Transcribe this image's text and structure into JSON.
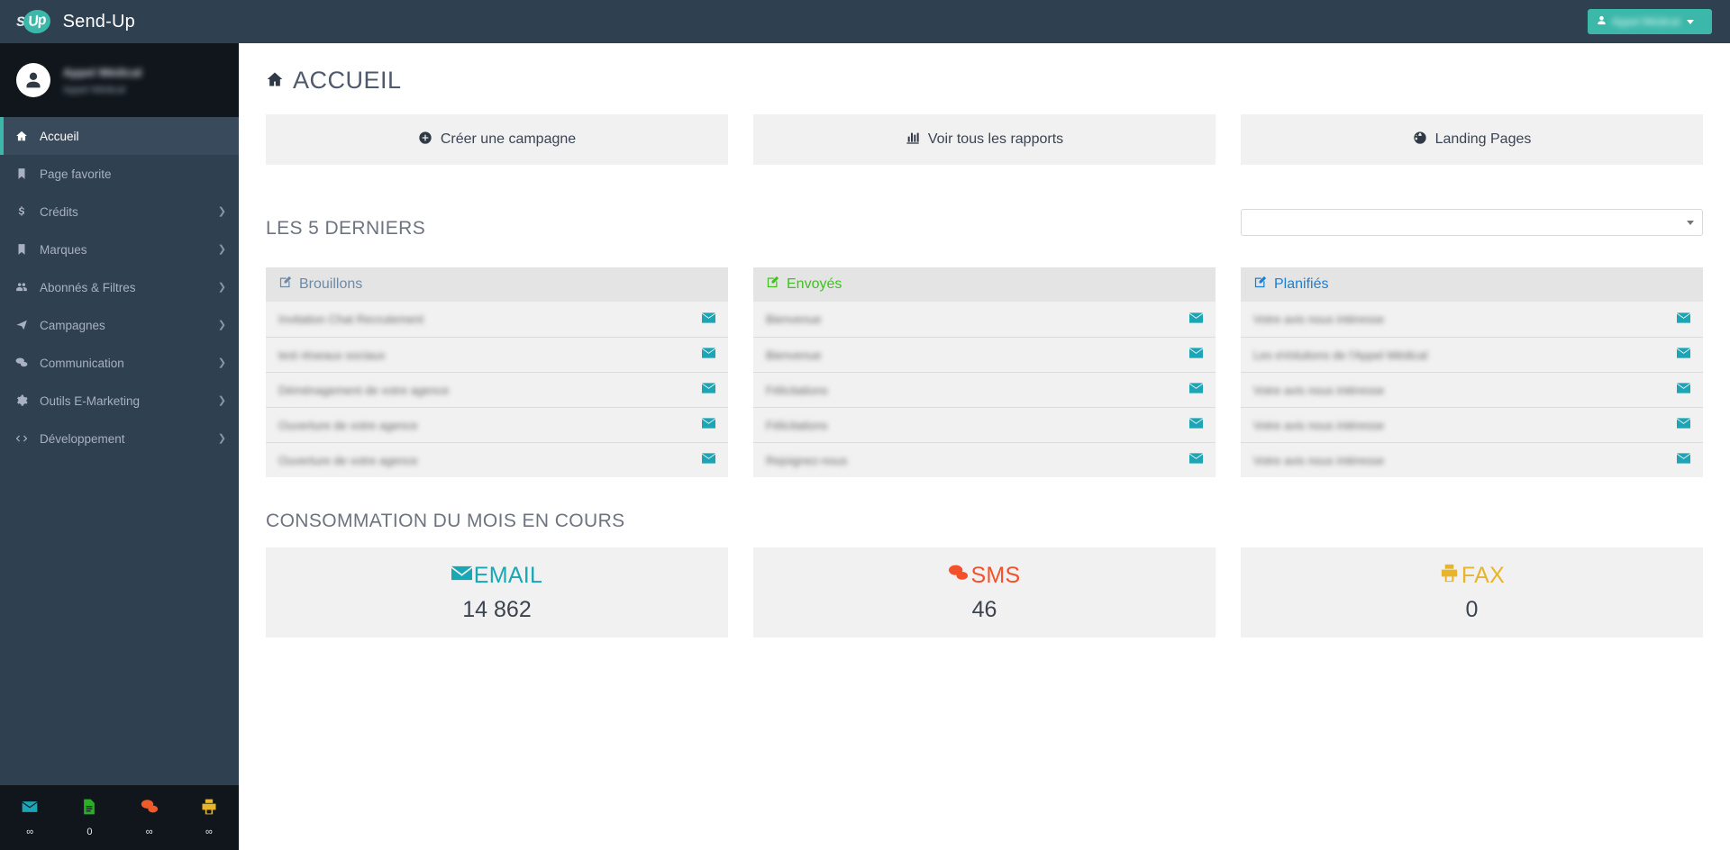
{
  "topbar": {
    "logo_s": "s",
    "logo_up": "Up",
    "brand_name": "Send-Up",
    "account_label": "Appel Médical",
    "account_icon": "user-icon",
    "caret_icon": "chevron-down-icon"
  },
  "sidebar": {
    "profile": {
      "name": "Appel Médical",
      "subtitle": "Appel Médical",
      "avatar_icon": "user-avatar-icon"
    },
    "items": [
      {
        "label": "Accueil",
        "icon": "home-icon",
        "active": true,
        "arrow": ""
      },
      {
        "label": "Page favorite",
        "icon": "bookmark-icon",
        "active": false,
        "arrow": ""
      },
      {
        "label": "Crédits",
        "icon": "dollar-icon",
        "active": false,
        "arrow": "❯"
      },
      {
        "label": "Marques",
        "icon": "bookmark-icon",
        "active": false,
        "arrow": "❯"
      },
      {
        "label": "Abonnés & Filtres",
        "icon": "users-icon",
        "active": false,
        "arrow": "❯"
      },
      {
        "label": "Campagnes",
        "icon": "paper-plane-icon",
        "active": false,
        "arrow": "❯"
      },
      {
        "label": "Communication",
        "icon": "comments-icon",
        "active": false,
        "arrow": "❯"
      },
      {
        "label": "Outils E-Marketing",
        "icon": "gear-icon",
        "active": false,
        "arrow": "❯"
      },
      {
        "label": "Développement",
        "icon": "code-icon",
        "active": false,
        "arrow": "❯"
      }
    ],
    "footer": [
      {
        "icon": "envelope-icon",
        "count": "∞",
        "color": "#1ba5b5"
      },
      {
        "icon": "file-text-icon",
        "count": "0",
        "color": "#2aad27"
      },
      {
        "icon": "comments-icon",
        "count": "∞",
        "color": "#f05a28"
      },
      {
        "icon": "fax-icon",
        "count": "∞",
        "color": "#e8b42c"
      }
    ]
  },
  "main": {
    "page_title": "ACCUEIL",
    "page_title_icon": "home-icon",
    "actions": [
      {
        "label": "Créer une campagne",
        "icon": "plus-circle-icon"
      },
      {
        "label": "Voir tous les rapports",
        "icon": "bar-chart-icon"
      },
      {
        "label": "Landing Pages",
        "icon": "globe-icon"
      }
    ],
    "latest_heading": "LES 5 DERNIERS",
    "brand_select": {
      "value": "",
      "placeholder": "",
      "caret_icon": "chevron-down-icon"
    },
    "panels": [
      {
        "title": "Brouillons",
        "title_color": "#6d8aa6",
        "icon": "edit-icon",
        "rows": [
          {
            "text": "Invitation Chat Recrutement",
            "icon": "envelope-icon"
          },
          {
            "text": "test réseaux sociaux",
            "icon": "envelope-icon"
          },
          {
            "text": "Déménagement de votre agence",
            "icon": "envelope-icon"
          },
          {
            "text": "Ouverture de votre agence",
            "icon": "envelope-icon"
          },
          {
            "text": "Ouverture de votre agence",
            "icon": "envelope-icon"
          }
        ]
      },
      {
        "title": "Envoyés",
        "title_color": "#3fc21f",
        "icon": "edit-icon",
        "rows": [
          {
            "text": "Bienvenue",
            "icon": "envelope-icon"
          },
          {
            "text": "Bienvenue",
            "icon": "envelope-icon"
          },
          {
            "text": "Félicitations",
            "icon": "envelope-icon"
          },
          {
            "text": "Félicitations",
            "icon": "envelope-icon"
          },
          {
            "text": "Rejoignez-nous",
            "icon": "envelope-icon"
          }
        ]
      },
      {
        "title": "Planifiés",
        "title_color": "#1b7fd4",
        "icon": "edit-icon",
        "rows": [
          {
            "text": "Votre avis nous intéresse",
            "icon": "envelope-icon"
          },
          {
            "text": "Les eVolutions de l'Appel Médical",
            "icon": "envelope-icon"
          },
          {
            "text": "Votre avis nous intéresse",
            "icon": "envelope-icon"
          },
          {
            "text": "Votre avis nous intéresse",
            "icon": "envelope-icon"
          },
          {
            "text": "Votre avis nous intéresse",
            "icon": "envelope-icon"
          }
        ]
      }
    ],
    "consumption_heading": "CONSOMMATION DU MOIS EN COURS",
    "stats": [
      {
        "label": "EMAIL",
        "value": "14 862",
        "icon": "envelope-icon",
        "color": "#18a7b5"
      },
      {
        "label": "SMS",
        "value": "46",
        "icon": "comments-icon",
        "color": "#f2512b"
      },
      {
        "label": "FAX",
        "value": "0",
        "icon": "fax-icon",
        "color": "#e8b42c"
      }
    ]
  }
}
